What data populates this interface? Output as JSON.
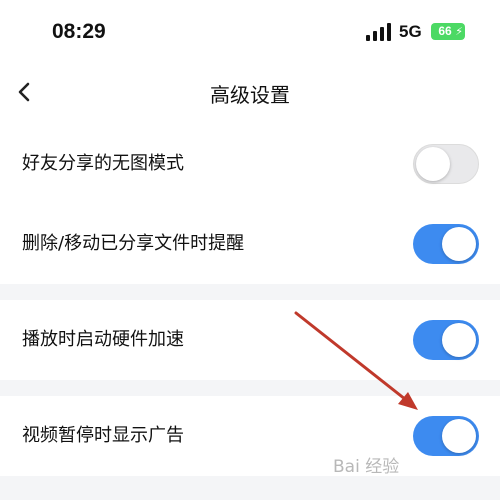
{
  "status_bar": {
    "time": "08:29",
    "network": "5G",
    "battery": "66",
    "icons": [
      "signal-bars-icon",
      "battery-charging-icon"
    ]
  },
  "nav": {
    "back_icon": "chevron-left-icon",
    "title": "高级设置"
  },
  "settings": [
    {
      "label": "好友分享的无图模式",
      "enabled": false
    },
    {
      "label": "删除/移动已分享文件时提醒",
      "enabled": true
    },
    {
      "label": "播放时启动硬件加速",
      "enabled": true
    },
    {
      "label": "视频暂停时显示广告",
      "enabled": true
    }
  ],
  "colors": {
    "toggle_on": "#3d8bf0",
    "toggle_off": "#e9e9eb",
    "section_gap": "#f4f5f7",
    "annotation_arrow": "#c0392b",
    "battery": "#4cd964"
  },
  "watermark": "Bai 经验"
}
